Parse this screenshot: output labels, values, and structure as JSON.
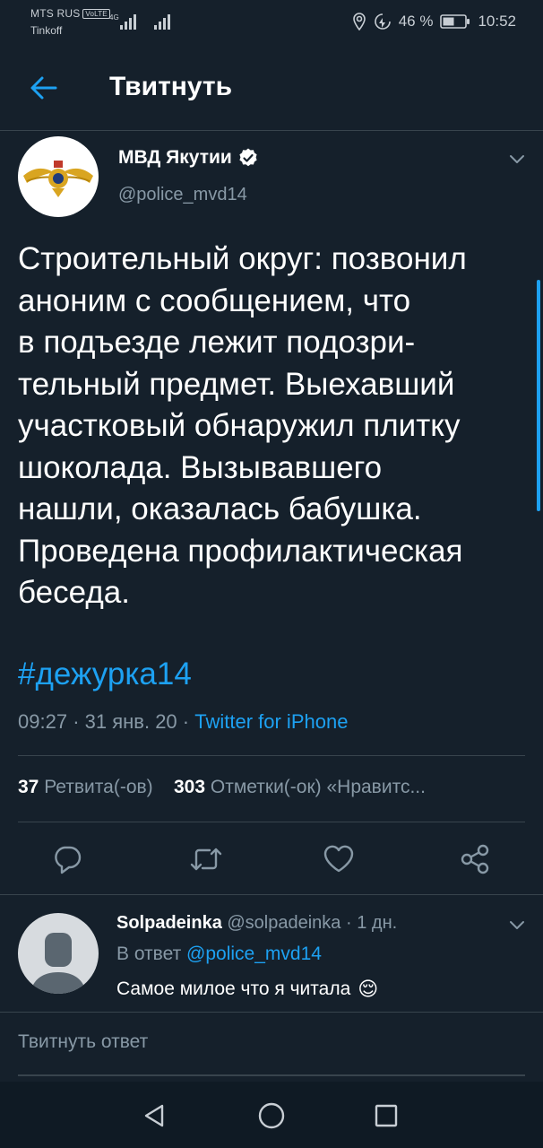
{
  "status_bar": {
    "carrier": "MTS RUS",
    "volte": "VoLTE",
    "network": "4G",
    "carrier2": "Tinkoff",
    "battery": "46 %",
    "time": "10:52"
  },
  "header": {
    "title": "Твитнуть"
  },
  "tweet": {
    "author_name": "МВД Якутии",
    "author_handle": "@police_mvd14",
    "text": "Строительный округ: позвонил\nаноним с сообщением, что\nв подъезде лежит подозри-\nтельный предмет. Выехавший\nучастковый обнаружил плитку\nшоколада. Вызывавшего\nнашли, оказалась бабушка.\nПроведена профилактическая\nбеседа.",
    "hashtag": "#дежурка14",
    "time": "09:27",
    "date": "31 янв. 20",
    "separator": "·",
    "source": "Twitter for iPhone",
    "retweets_count": "37",
    "retweets_label": "Ретвита(-ов)",
    "likes_count": "303",
    "likes_label": "Отметки(-ок) «Нравитс..."
  },
  "reply": {
    "author_name": "Solpadeinka",
    "author_handle": "@solpadeinka",
    "age": "· 1 дн.",
    "reply_prefix": "В ответ",
    "reply_to": "@police_mvd14",
    "text": "Самое милое что я читала",
    "emoji": "😌"
  },
  "compose": {
    "placeholder": "Твитнуть ответ"
  },
  "colors": {
    "background": "#15202b",
    "accent": "#1da1f2",
    "muted": "#8899a6",
    "divider": "#38444d"
  }
}
